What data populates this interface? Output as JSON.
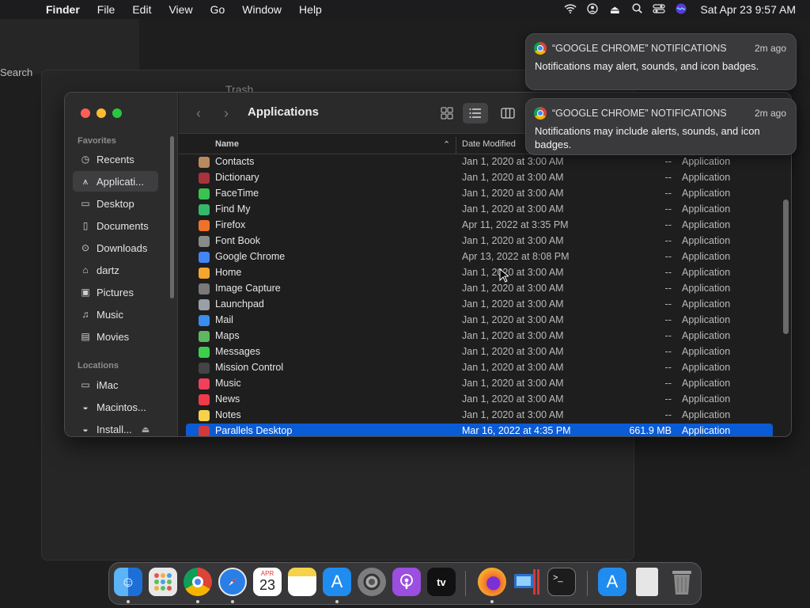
{
  "menubar": {
    "items": [
      "Finder",
      "File",
      "Edit",
      "View",
      "Go",
      "Window",
      "Help"
    ],
    "clock": "Sat Apr 23  9:57 AM",
    "icons": [
      "wifi-icon",
      "user-icon",
      "eject-icon",
      "search-icon",
      "control-center-icon",
      "siri-icon"
    ]
  },
  "background": {
    "search": "Search",
    "trash_title": "Trash"
  },
  "finder": {
    "title": "Applications",
    "sidebar": {
      "favorites_label": "Favorites",
      "favorites": [
        {
          "label": "Recents",
          "icon": "clock-icon"
        },
        {
          "label": "Applicati...",
          "icon": "apps-icon"
        },
        {
          "label": "Desktop",
          "icon": "desktop-icon"
        },
        {
          "label": "Documents",
          "icon": "document-icon"
        },
        {
          "label": "Downloads",
          "icon": "download-icon"
        },
        {
          "label": "dartz",
          "icon": "home-icon"
        },
        {
          "label": "Pictures",
          "icon": "pictures-icon"
        },
        {
          "label": "Music",
          "icon": "music-icon"
        },
        {
          "label": "Movies",
          "icon": "movies-icon"
        }
      ],
      "locations_label": "Locations",
      "locations": [
        {
          "label": "iMac",
          "icon": "imac-icon"
        },
        {
          "label": "Macintos...",
          "icon": "disk-icon"
        },
        {
          "label": "Install...",
          "icon": "disk-icon"
        }
      ]
    },
    "columns": {
      "name": "Name",
      "date": "Date Modified"
    },
    "rows": [
      {
        "name": "Contacts",
        "date": "Jan 1, 2020 at 3:00 AM",
        "size": "--",
        "kind": "Application",
        "color": "#b98a5e"
      },
      {
        "name": "Dictionary",
        "date": "Jan 1, 2020 at 3:00 AM",
        "size": "--",
        "kind": "Application",
        "color": "#a8333a"
      },
      {
        "name": "FaceTime",
        "date": "Jan 1, 2020 at 3:00 AM",
        "size": "--",
        "kind": "Application",
        "color": "#3cc24f"
      },
      {
        "name": "Find My",
        "date": "Jan 1, 2020 at 3:00 AM",
        "size": "--",
        "kind": "Application",
        "color": "#35b86a"
      },
      {
        "name": "Firefox",
        "date": "Apr 11, 2022 at 3:35 PM",
        "size": "--",
        "kind": "Application",
        "color": "#f0722a"
      },
      {
        "name": "Font Book",
        "date": "Jan 1, 2020 at 3:00 AM",
        "size": "--",
        "kind": "Application",
        "color": "#8a8a8a"
      },
      {
        "name": "Google Chrome",
        "date": "Apr 13, 2022 at 8:08 PM",
        "size": "--",
        "kind": "Application",
        "color": "#4285f4"
      },
      {
        "name": "Home",
        "date": "Jan 1, 2020 at 3:00 AM",
        "size": "--",
        "kind": "Application",
        "color": "#f2a630"
      },
      {
        "name": "Image Capture",
        "date": "Jan 1, 2020 at 3:00 AM",
        "size": "--",
        "kind": "Application",
        "color": "#7a7a7a"
      },
      {
        "name": "Launchpad",
        "date": "Jan 1, 2020 at 3:00 AM",
        "size": "--",
        "kind": "Application",
        "color": "#9aa0a8"
      },
      {
        "name": "Mail",
        "date": "Jan 1, 2020 at 3:00 AM",
        "size": "--",
        "kind": "Application",
        "color": "#3a8df0"
      },
      {
        "name": "Maps",
        "date": "Jan 1, 2020 at 3:00 AM",
        "size": "--",
        "kind": "Application",
        "color": "#5fb85f"
      },
      {
        "name": "Messages",
        "date": "Jan 1, 2020 at 3:00 AM",
        "size": "--",
        "kind": "Application",
        "color": "#3ccf4e"
      },
      {
        "name": "Mission Control",
        "date": "Jan 1, 2020 at 3:00 AM",
        "size": "--",
        "kind": "Application",
        "color": "#444444"
      },
      {
        "name": "Music",
        "date": "Jan 1, 2020 at 3:00 AM",
        "size": "--",
        "kind": "Application",
        "color": "#f0405a"
      },
      {
        "name": "News",
        "date": "Jan 1, 2020 at 3:00 AM",
        "size": "--",
        "kind": "Application",
        "color": "#f03a4a"
      },
      {
        "name": "Notes",
        "date": "Jan 1, 2020 at 3:00 AM",
        "size": "--",
        "kind": "Application",
        "color": "#f6d24a"
      },
      {
        "name": "Parallels Desktop",
        "date": "Mar 16, 2022 at 4:35 PM",
        "size": "661.9 MB",
        "kind": "Application",
        "color": "#d23a3a",
        "selected": true
      }
    ]
  },
  "notifications": [
    {
      "app": "“GOOGLE CHROME” NOTIFICATIONS",
      "time": "2m ago",
      "body": "Notifications may alert, sounds, and icon badges."
    },
    {
      "app": "“GOOGLE CHROME” NOTIFICATIONS",
      "time": "2m ago",
      "body": "Notifications may include alerts, sounds, and icon badges."
    }
  ],
  "dock": {
    "calendar_month": "APR",
    "calendar_day": "23",
    "tv_label": "tv",
    "items": [
      "finder-icon",
      "launchpad-icon",
      "chrome-icon",
      "safari-icon",
      "calendar-icon",
      "notes-icon",
      "app-store-icon",
      "system-preferences-icon",
      "podcasts-icon",
      "apple-tv-icon",
      "firefox-icon",
      "parallels-icon",
      "terminal-icon",
      "applications-folder-icon",
      "documents-stack-icon",
      "trash-icon"
    ]
  },
  "colors": {
    "selection": "#0a5bd6",
    "close": "#ff5f57",
    "minimize": "#febc2e",
    "zoom": "#28c840"
  }
}
